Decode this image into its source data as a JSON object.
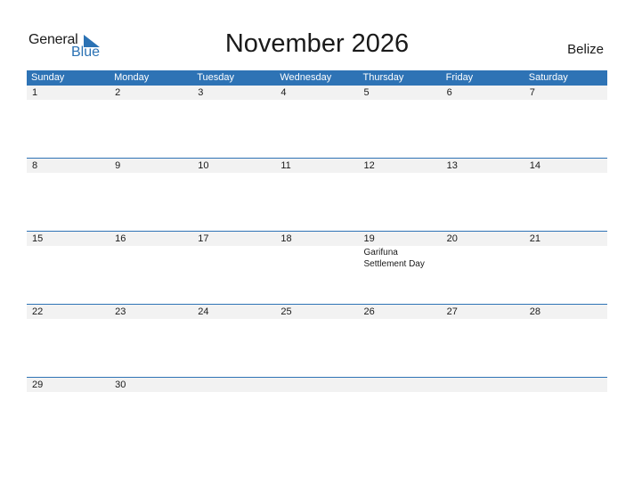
{
  "logo": {
    "general": "General",
    "blue": "Blue"
  },
  "title": "November 2026",
  "country": "Belize",
  "colors": {
    "header_bg": "#2e73b5",
    "date_strip": "#f2f2f2",
    "accent": "#2b72b4"
  },
  "weekdays": [
    "Sunday",
    "Monday",
    "Tuesday",
    "Wednesday",
    "Thursday",
    "Friday",
    "Saturday"
  ],
  "weeks": [
    [
      {
        "day": "1"
      },
      {
        "day": "2"
      },
      {
        "day": "3"
      },
      {
        "day": "4"
      },
      {
        "day": "5"
      },
      {
        "day": "6"
      },
      {
        "day": "7"
      }
    ],
    [
      {
        "day": "8"
      },
      {
        "day": "9"
      },
      {
        "day": "10"
      },
      {
        "day": "11"
      },
      {
        "day": "12"
      },
      {
        "day": "13"
      },
      {
        "day": "14"
      }
    ],
    [
      {
        "day": "15"
      },
      {
        "day": "16"
      },
      {
        "day": "17"
      },
      {
        "day": "18"
      },
      {
        "day": "19",
        "event": "Garifuna Settlement Day"
      },
      {
        "day": "20"
      },
      {
        "day": "21"
      }
    ],
    [
      {
        "day": "22"
      },
      {
        "day": "23"
      },
      {
        "day": "24"
      },
      {
        "day": "25"
      },
      {
        "day": "26"
      },
      {
        "day": "27"
      },
      {
        "day": "28"
      }
    ],
    [
      {
        "day": "29"
      },
      {
        "day": "30"
      },
      {
        "day": ""
      },
      {
        "day": ""
      },
      {
        "day": ""
      },
      {
        "day": ""
      },
      {
        "day": ""
      }
    ]
  ]
}
